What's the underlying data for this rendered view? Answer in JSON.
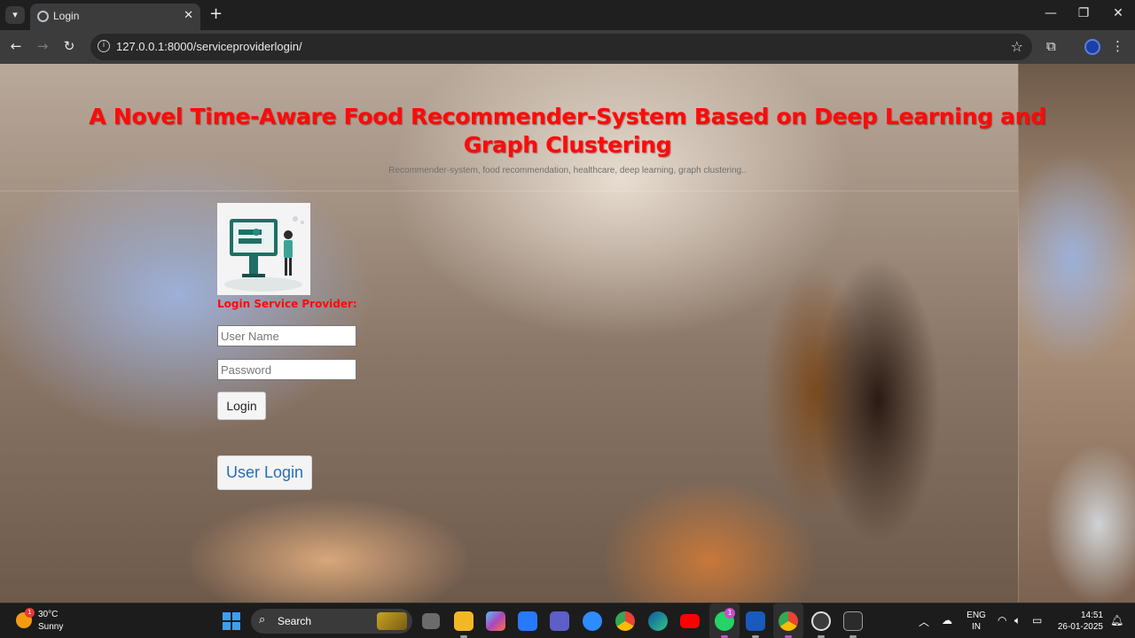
{
  "browser": {
    "tab": {
      "title": "Login"
    },
    "address_bar": {
      "url": "127.0.0.1:8000/serviceproviderlogin/"
    }
  },
  "page": {
    "title": "A Novel Time-Aware Food Recommender-System Based on Deep Learning and Graph Clustering",
    "subtitle": "Recommender-system, food recommendation, healthcare, deep learning, graph clustering..",
    "login_heading": "Login Service Provider:",
    "username_placeholder": "User Name",
    "password_placeholder": "Password",
    "login_button": "Login",
    "user_login_button": "User Login"
  },
  "taskbar": {
    "weather": {
      "temperature": "30°C",
      "condition": "Sunny",
      "badge": "1"
    },
    "search_label": "Search",
    "whatsapp_badge": "1",
    "language": {
      "line1": "ENG",
      "line2": "IN"
    },
    "clock": {
      "time": "14:51",
      "date": "26-01-2025"
    }
  }
}
